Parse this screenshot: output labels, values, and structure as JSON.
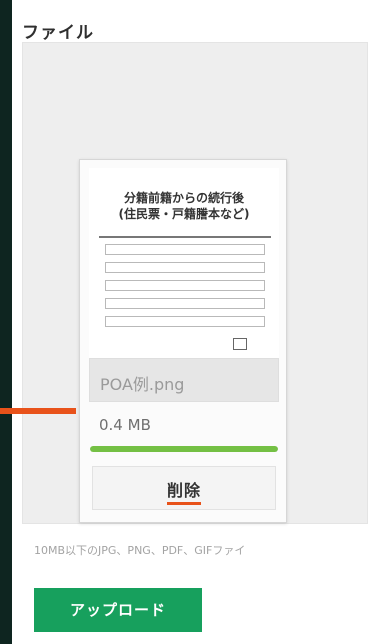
{
  "section_label": "ファイル",
  "file": {
    "thumbnail_title_line1": "分籍前籍からの続行後",
    "thumbnail_title_line2": "(住民票・戸籍謄本など)",
    "name": "POA例.png",
    "size": "0.4 MB",
    "upload_progress_percent": 100,
    "delete_label": "削除"
  },
  "hint_text": "10MB以下のJPG、PNG、PDF、GIFファイ",
  "upload_label": "アップロード",
  "colors": {
    "accent_green": "#17a05d",
    "progress_green": "#74c044",
    "highlight_orange": "#e8521a"
  }
}
